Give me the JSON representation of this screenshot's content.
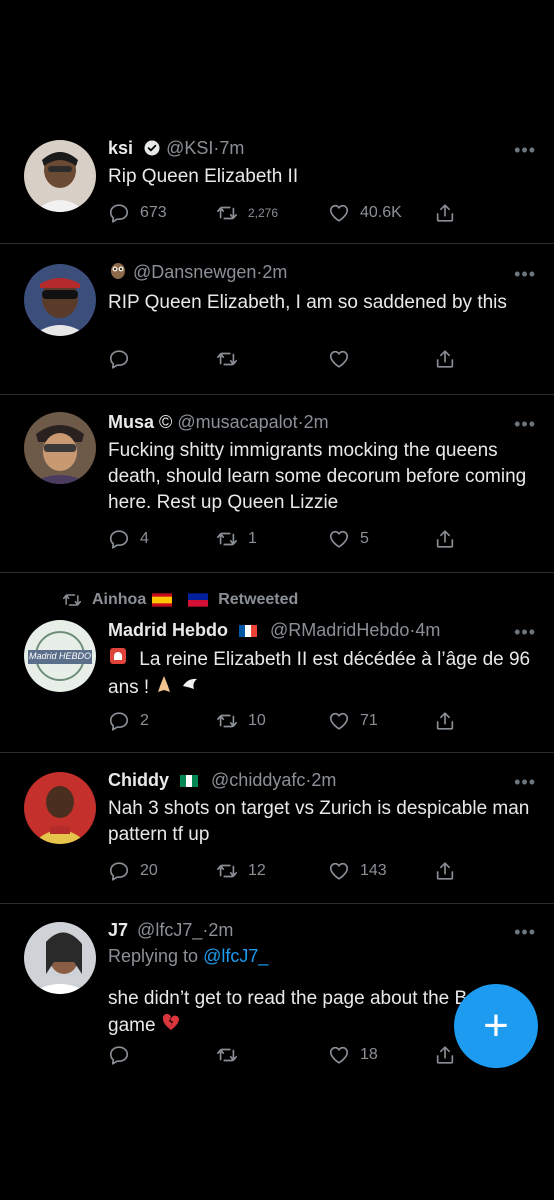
{
  "tweets": [
    {
      "name": "ksi",
      "handle": "@KSI",
      "time": "7m",
      "text": "Rip Queen Elizabeth II",
      "reply_count": "673",
      "retweet_count": "2,276",
      "like_count": "40.6K"
    },
    {
      "name": "",
      "handle": "@Dansnewgen",
      "time": "2m",
      "text": "RIP Queen Elizabeth, I am so saddened by this",
      "reply_count": "",
      "retweet_count": "",
      "like_count": ""
    },
    {
      "name": "Musa",
      "name_symbol": "©",
      "handle": "@musacapalot",
      "time": "2m",
      "text": "Fucking shitty immigrants mocking the queens death, should learn some decorum before coming here. Rest up Queen Lizzie",
      "reply_count": "4",
      "retweet_count": "1",
      "like_count": "5"
    },
    {
      "retweeted_by": "Ainhoa",
      "retweeted_label": "Retweeted",
      "name": "Madrid Hebdo",
      "handle": "@RMadridHebdo",
      "time": "4m",
      "text_main": "La reine Elizabeth II est décédée à l’âge de 96 ans !",
      "reply_count": "2",
      "retweet_count": "10",
      "like_count": "71",
      "avatar_text": "Madrid HEBDO"
    },
    {
      "name": "Chiddy",
      "handle": "@chiddyafc",
      "time": "2m",
      "text": "Nah 3 shots on target vs Zurich is despicable man pattern tf up",
      "reply_count": "20",
      "retweet_count": "12",
      "like_count": "143"
    },
    {
      "name": "J7",
      "handle": "@lfcJ7_",
      "time": "2m",
      "replying_label": "Replying to",
      "replying_handle": "@lfcJ7_",
      "text": "she didn’t get to read the page about the Barca game",
      "reply_count": "",
      "retweet_count": "",
      "like_count": "18"
    }
  ],
  "separator": "·",
  "more_label": "•••",
  "fab_label": "+",
  "icons": [
    "reply-icon",
    "retweet-icon",
    "like-icon",
    "share-icon",
    "verified-badge-icon",
    "compose-icon"
  ],
  "colors": {
    "background": "#000000",
    "text": "#e7e9ea",
    "muted": "#8b9096",
    "accent": "#1d9bf0"
  }
}
